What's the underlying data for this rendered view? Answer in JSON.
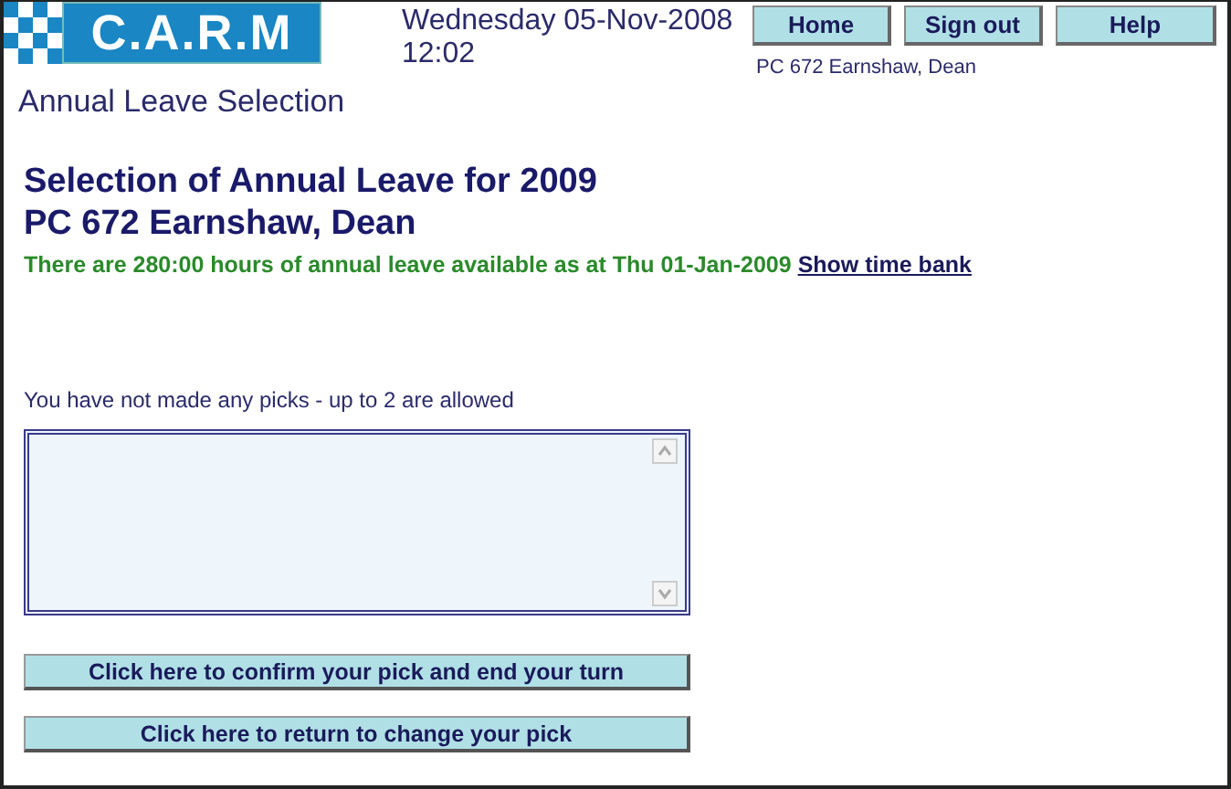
{
  "logo": {
    "text": "C.A.R.M"
  },
  "header": {
    "date": "Wednesday 05-Nov-2008",
    "time": "12:02",
    "user": "PC 672 Earnshaw, Dean"
  },
  "nav_buttons": [
    "Home",
    "Sign out",
    "Help"
  ],
  "page_title": "Annual Leave Selection",
  "heading": [
    "Selection of Annual Leave for 2009",
    "PC 672 Earnshaw, Dean"
  ],
  "availability": {
    "text": "There are 280:00 hours of annual leave available as at Thu 01-Jan-2009",
    "link": "Show time bank"
  },
  "picks_note": "You have not made any picks - up to 2 are allowed",
  "action_buttons": [
    "Click here to confirm your pick and end your turn",
    "Click here to return to change your pick"
  ]
}
